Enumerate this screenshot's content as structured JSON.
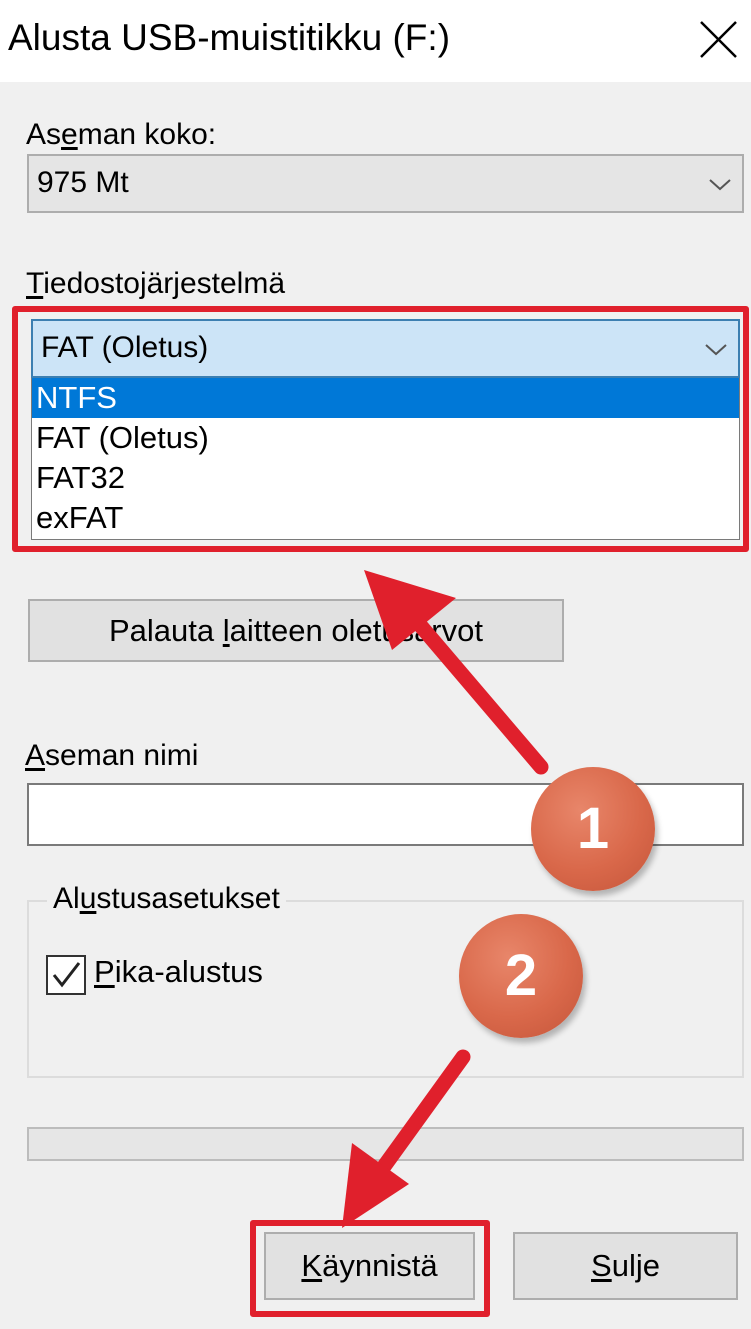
{
  "window": {
    "title": "Alusta USB-muistitikku (F:)",
    "close_icon": "close-icon"
  },
  "capacity": {
    "label_before": "As",
    "label_accel": "e",
    "label_after": "man koko:",
    "value": "975 Mt"
  },
  "filesystem": {
    "label_accel": "T",
    "label_after": "iedostojärjestelmä",
    "value": "FAT (Oletus)",
    "options": [
      {
        "label": "NTFS",
        "selected": true
      },
      {
        "label": "FAT (Oletus)",
        "selected": false
      },
      {
        "label": "FAT32",
        "selected": false
      },
      {
        "label": "exFAT",
        "selected": false
      }
    ]
  },
  "restore_button": {
    "label_before": "Palauta ",
    "label_accel": "l",
    "label_after": "aitteen oletusarvot"
  },
  "volume_label": {
    "label_accel": "A",
    "label_after": "seman nimi",
    "value": ""
  },
  "format_options": {
    "legend_before": "Al",
    "legend_accel": "u",
    "legend_after": "stusasetukset",
    "quick_format": {
      "label_accel": "P",
      "label_after": "ika-alustus",
      "checked": true
    }
  },
  "progress": {
    "value": 0
  },
  "buttons": {
    "start": {
      "label_accel": "K",
      "label_after": "äynnistä"
    },
    "close": {
      "label_accel": "S",
      "label_after": "ulje"
    }
  },
  "annotations": {
    "badge_1": "1",
    "badge_2": "2",
    "highlight_color": "#e0202c",
    "arrow_color": "#e0202c",
    "badge_color": "#d9684a"
  },
  "colors": {
    "window_bg": "#f0f0f0",
    "selection": "#0078d7",
    "combo_focus": "#cce4f7"
  }
}
